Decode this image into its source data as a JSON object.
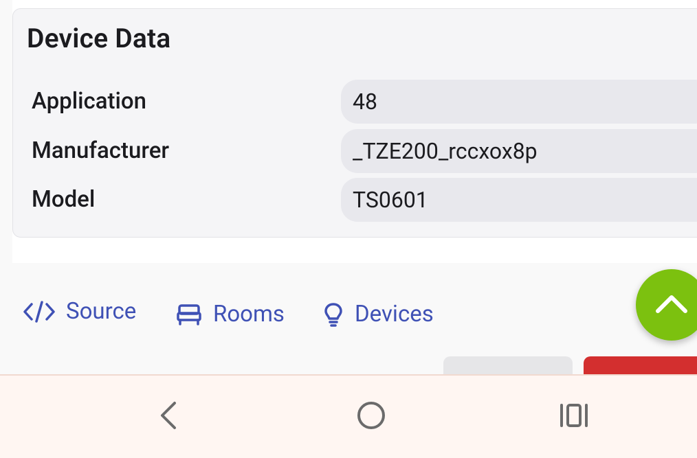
{
  "card": {
    "title": "Device Data",
    "rows": [
      {
        "label": "Application",
        "value": "48"
      },
      {
        "label": "Manufacturer",
        "value": "_TZE200_rccxox8p"
      },
      {
        "label": "Model",
        "value": "TS0601"
      }
    ]
  },
  "links": [
    {
      "label": "Source",
      "icon": "code-icon"
    },
    {
      "label": "Rooms",
      "icon": "bed-icon"
    },
    {
      "label": "Devices",
      "icon": "lightbulb-icon"
    }
  ],
  "fab": {
    "icon": "chevron-up-icon",
    "color": "#7cc10f"
  },
  "colors": {
    "link": "#3f51b5",
    "danger": "#d32f2f",
    "navbar": "#fff6f2"
  },
  "navbar": {
    "icons": [
      "back-icon",
      "home-icon",
      "recents-icon"
    ]
  }
}
